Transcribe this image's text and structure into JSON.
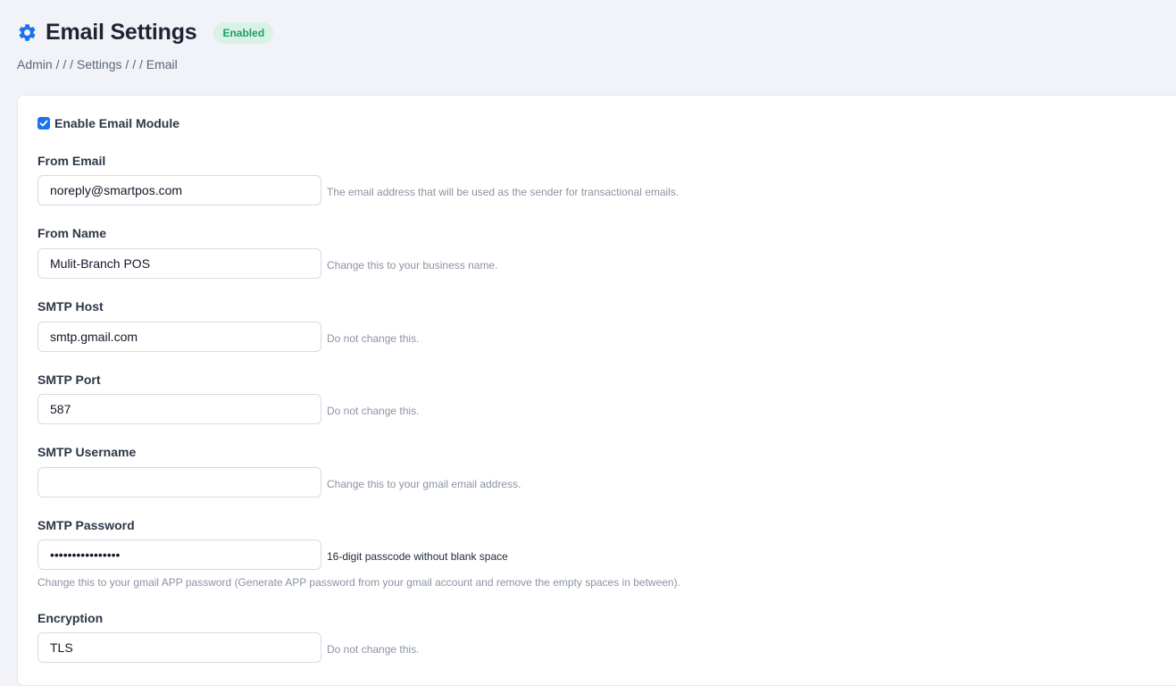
{
  "header": {
    "title": "Email Settings",
    "badge": "Enabled"
  },
  "breadcrumb": [
    "Admin",
    "/",
    "/ /",
    "Settings",
    "/",
    "/ /",
    "Email"
  ],
  "form": {
    "enable_label": "Enable Email Module",
    "enable_checked": true,
    "fields": [
      {
        "label": "From Email",
        "value": "noreply@smartpos.com",
        "help": "The email address that will be used as the sender for transactional emails."
      },
      {
        "label": "From Name",
        "value": "Mulit-Branch POS",
        "help": "Change this to your business name."
      },
      {
        "label": "SMTP Host",
        "value": "smtp.gmail.com",
        "help": "Do not change this."
      },
      {
        "label": "SMTP Port",
        "value": "587",
        "help": "Do not change this."
      },
      {
        "label": "SMTP Username",
        "value": "",
        "help": "Change this to your gmail email address."
      },
      {
        "label": "SMTP Password",
        "value": "••••••••••••••••",
        "help": "16-digit passcode without blank space",
        "help2": "Change this to your gmail APP password (Generate APP password from your gmail account and remove the empty spaces in between)."
      },
      {
        "label": "Encryption",
        "value": "TLS",
        "help": "Do not change this."
      }
    ]
  },
  "colors": {
    "accent": "#1a73e8",
    "badge_bg": "#d9f2e6",
    "badge_text": "#1e9e63",
    "page_bg": "#f1f3f8"
  },
  "icons": {
    "title_icon": "gear-icon",
    "checkbox": "checkmark-icon"
  }
}
